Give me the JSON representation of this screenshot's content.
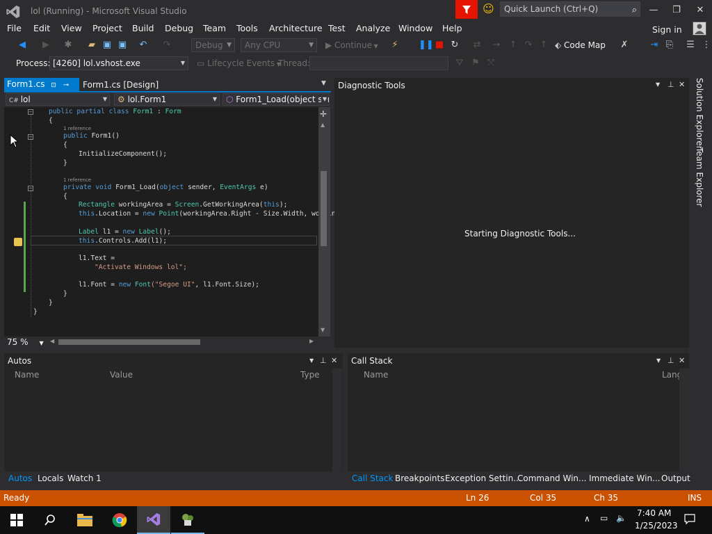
{
  "window": {
    "title": "lol (Running) - Microsoft Visual Studio",
    "quick_launch_placeholder": "Quick Launch (Ctrl+Q)",
    "minimize": "—",
    "restore": "❐",
    "close": "✕"
  },
  "menu": {
    "items": [
      "File",
      "Edit",
      "View",
      "Project",
      "Build",
      "Debug",
      "Team",
      "Tools",
      "Architecture",
      "Test",
      "Analyze",
      "Window",
      "Help"
    ],
    "sign_in": "Sign in"
  },
  "toolbar": {
    "config": "Debug",
    "platform": "Any CPU",
    "continue": "Continue",
    "code_map": "Code Map"
  },
  "debug_location": {
    "process_label": "Process:",
    "process_value": "[4260] lol.vshost.exe",
    "lifecycle_events": "Lifecycle Events",
    "thread_label": "Thread:"
  },
  "editor": {
    "tabs": [
      {
        "label": "Form1.cs",
        "active": true
      },
      {
        "label": "Form1.cs [Design]",
        "active": false
      }
    ],
    "nav": {
      "project": "lol",
      "class": "lol.Form1",
      "member": "Form1_Load(object sender, EventArgs e)"
    },
    "ref_text": "1 reference",
    "code": {
      "l1_kw": "public partial class ",
      "l1_name": "Form1",
      "l1_sep": " : ",
      "l1_base": "Form",
      "l2": "{",
      "l3_kw": "public ",
      "l3_rest": "Form1()",
      "l4": "{",
      "l5": "InitializeComponent();",
      "l6": "}",
      "l7_kw": "private void ",
      "l7_name": "Form1_Load(",
      "l7_t1": "object",
      "l7_p1": " sender, ",
      "l7_t2": "EventArgs",
      "l7_p2": " e)",
      "l8": "{",
      "l9_type": "Rectangle",
      "l9_mid": " workingArea = ",
      "l9_cls": "Screen",
      "l9_rest": ".GetWorkingArea(",
      "l9_this": "this",
      "l9_end": ");",
      "l10_this": "this",
      "l10_mid": ".Location = ",
      "l10_new": "new ",
      "l10_type": "Point",
      "l10_rest": "(workingArea.Right - Size.Width, workin",
      "l11_type": "Label",
      "l11_mid": " l1 = ",
      "l11_new": "new ",
      "l11_type2": "Label",
      "l11_end": "();",
      "l12_this": "this",
      "l12_rest": ".Controls.Add(l1);",
      "l13": "l1.Text =",
      "l14": "\"Activate Windows lol\";",
      "l15_a": "l1.Font = ",
      "l15_new": "new ",
      "l15_type": "Font",
      "l15_str": "(\"Segoe UI\"",
      "l15_end": ", l1.Font.Size);",
      "l16": "}",
      "l17": "}",
      "l18": "}"
    },
    "zoom": "75 %"
  },
  "diagnostic_tools": {
    "title": "Diagnostic Tools",
    "status": "Starting Diagnostic Tools..."
  },
  "side_tabs": [
    "Solution Explorer",
    "Team Explorer"
  ],
  "autos": {
    "title": "Autos",
    "columns": [
      "Name",
      "Value",
      "Type"
    ],
    "tabs": [
      "Autos",
      "Locals",
      "Watch 1"
    ]
  },
  "call_stack": {
    "title": "Call Stack",
    "columns": [
      "Name",
      "Lang"
    ],
    "tabs": [
      "Call Stack",
      "Breakpoints",
      "Exception Settin...",
      "Command Win...",
      "Immediate Win...",
      "Output"
    ]
  },
  "status_bar": {
    "state": "Ready",
    "line": "Ln 26",
    "col": "Col 35",
    "ch": "Ch 35",
    "mode": "INS"
  },
  "taskbar": {
    "time": "7:40 AM",
    "date": "1/25/2023"
  },
  "colors": {
    "accent": "#007acc",
    "status_bar": "#ca5100",
    "background": "#2d2d30"
  }
}
